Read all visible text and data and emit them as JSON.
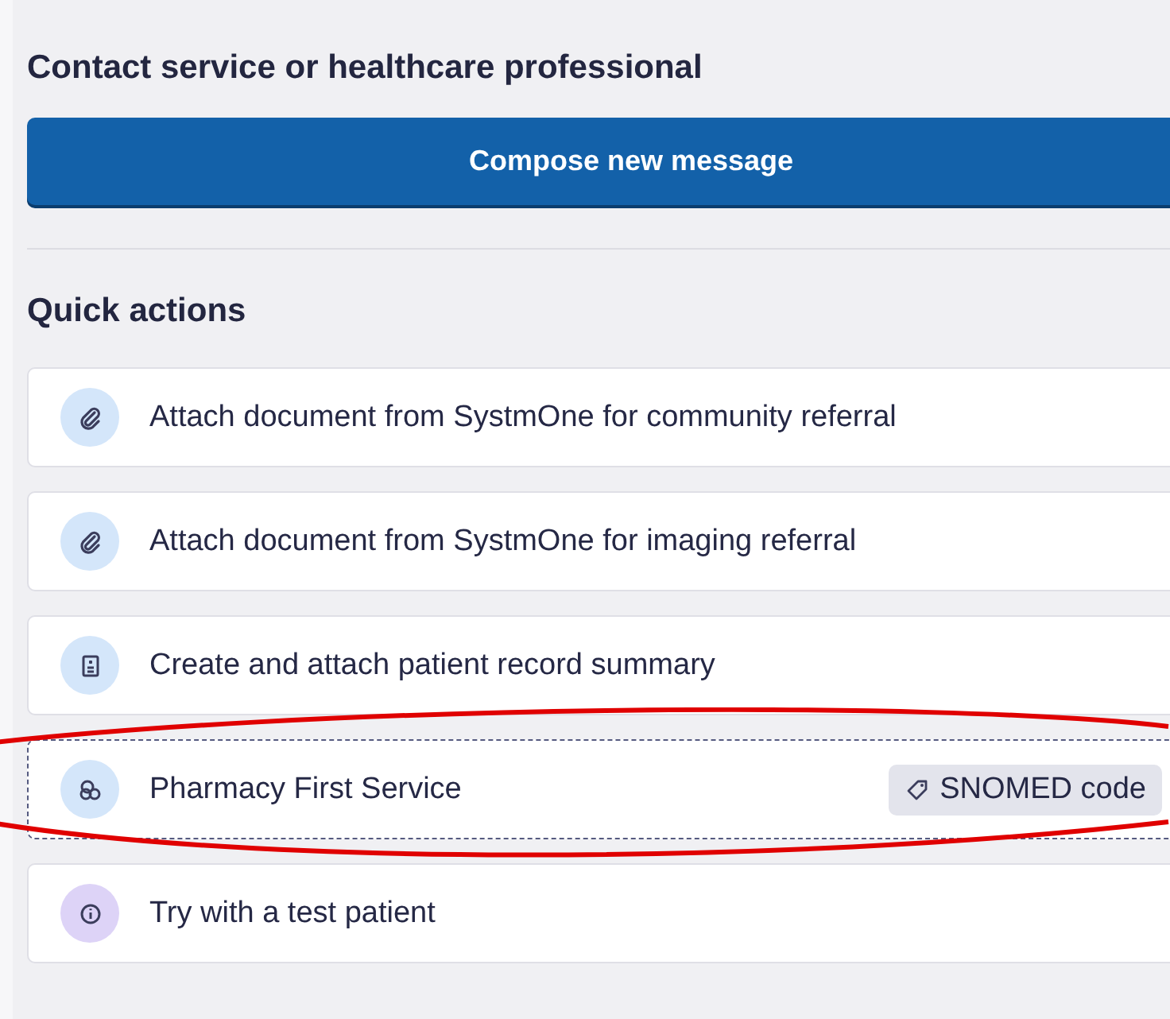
{
  "contact": {
    "heading": "Contact service or healthcare professional",
    "button": "Compose new message"
  },
  "quick_actions": {
    "heading": "Quick actions",
    "items": [
      {
        "kind": "attach",
        "label": "Attach document from SystmOne for community referral",
        "focused": false
      },
      {
        "kind": "attach",
        "label": "Attach document from SystmOne for imaging referral",
        "focused": false
      },
      {
        "kind": "record",
        "label": "Create and attach patient record summary",
        "focused": false
      },
      {
        "kind": "service",
        "label": "Pharmacy First Service",
        "focused": true,
        "tag": "SNOMED code"
      },
      {
        "kind": "test",
        "label": "Try with a test patient",
        "focused": false
      }
    ]
  }
}
